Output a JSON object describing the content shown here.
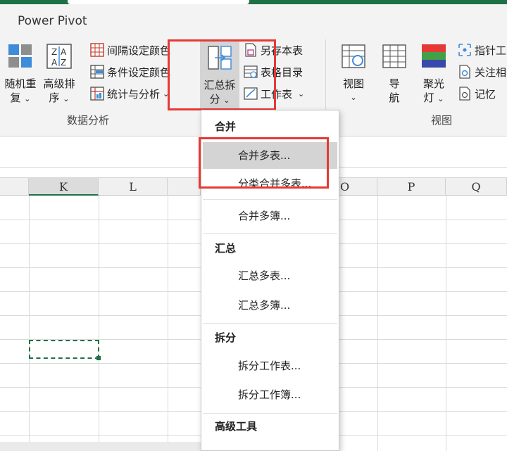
{
  "ribbon": {
    "tab": "Power Pivot",
    "groups": {
      "data_analysis": {
        "label": "数据分析",
        "random_line1": "随机重",
        "random_line2": "复",
        "sort_line1": "高级排",
        "sort_line2": "序",
        "interval_color": "间隔设定颜色",
        "condition_color": "条件设定颜色",
        "stats_analysis": "统计与分析",
        "summary_line1": "汇总拆",
        "summary_line2": "分",
        "save_table": "另存本表",
        "table_directory": "表格目录",
        "worksheet": "工作表"
      },
      "view": {
        "label": "视图",
        "view_btn": "视图",
        "nav_line1": "导",
        "nav_line2": "航",
        "spotlight_line1": "聚光",
        "spotlight_line2": "灯",
        "pointer": "指针工",
        "follow": "关注相",
        "memory": "记忆"
      }
    },
    "colors": {
      "accent": "#1e7145",
      "highlight": "#e53935"
    }
  },
  "grid": {
    "columns": [
      "K",
      "L",
      "O",
      "P",
      "Q"
    ],
    "active_column": "K"
  },
  "dropdown": {
    "sections": [
      {
        "header": "合并",
        "items": [
          "合并多表...",
          "分类合并多表...",
          "合并多簿..."
        ]
      },
      {
        "header": "汇总",
        "items": [
          "汇总多表...",
          "汇总多簿..."
        ]
      },
      {
        "header": "拆分",
        "items": [
          "拆分工作表...",
          "拆分工作簿..."
        ]
      },
      {
        "header": "高级工具",
        "items": []
      }
    ],
    "hovered_item": "合并多表..."
  }
}
